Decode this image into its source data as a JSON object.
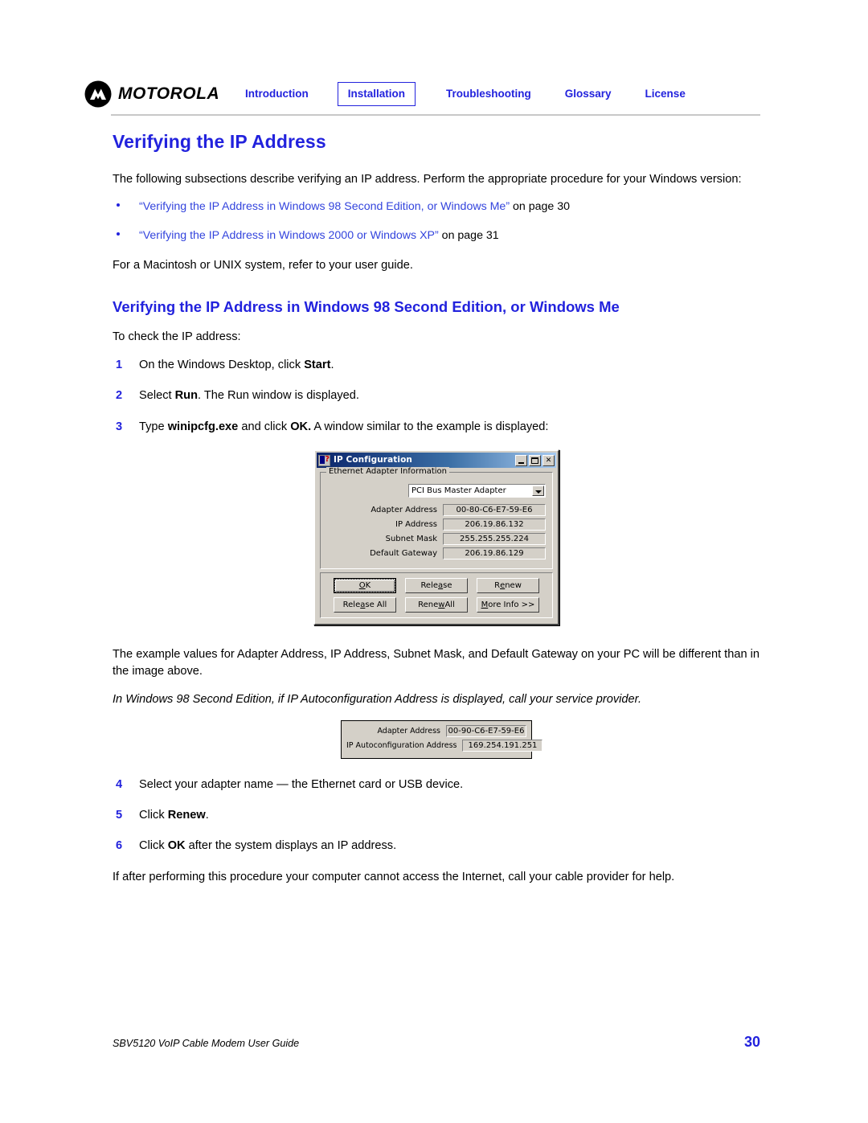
{
  "header": {
    "logo_text": "MOTOROLA",
    "logo_icon": "motorola-batwing-logo",
    "nav": [
      {
        "label": "Introduction",
        "active": false
      },
      {
        "label": "Installation",
        "active": true
      },
      {
        "label": "Troubleshooting",
        "active": false
      },
      {
        "label": "Glossary",
        "active": false
      },
      {
        "label": "License",
        "active": false
      }
    ],
    "accent_color": "#2222dd"
  },
  "main": {
    "title": "Verifying the IP Address",
    "intro": "The following subsections describe verifying an IP address. Perform the appropriate procedure for your Windows version:",
    "bullets": [
      {
        "link": "“Verifying the IP Address in Windows 98 Second Edition, or Windows Me”",
        "suffix": " on page 30"
      },
      {
        "link": "“Verifying the IP Address in Windows 2000 or Windows XP”",
        "suffix": " on page 31"
      }
    ],
    "macintosh_note": "For a Macintosh or UNIX system, refer to your user guide.",
    "subtitle": "Verifying the IP Address in Windows 98 Second Edition, or Windows Me",
    "lead_in": "To check the IP address:",
    "steps_first": [
      {
        "num": "1",
        "pre": "On the Windows Desktop, click ",
        "bold": "Start",
        "post": "."
      },
      {
        "num": "2",
        "pre": "Select ",
        "bold": "Run",
        "post": ". The Run window is displayed."
      },
      {
        "num": "3",
        "pre": "Type ",
        "bold": "winipcfg.exe",
        "mid": " and click ",
        "bold2": "OK.",
        "post": " A window similar to the example is displayed:"
      }
    ],
    "after_dialog": "The example values for Adapter Address, IP Address, Subnet Mask, and Default Gateway on your PC will be different than in the image above.",
    "italic_note": "In Windows 98 Second Edition, if IP Autoconfiguration Address is displayed, call your service provider.",
    "steps_second": [
      {
        "num": "4",
        "pre": "Select your adapter name — the Ethernet card or USB device.",
        "bold": "",
        "post": ""
      },
      {
        "num": "5",
        "pre": "Click ",
        "bold": "Renew",
        "post": "."
      },
      {
        "num": "6",
        "pre": "Click ",
        "bold": "OK",
        "post": " after the system displays an IP address."
      }
    ],
    "closing": "If after performing this procedure your computer cannot access the Internet, call your cable provider for help."
  },
  "dialog": {
    "title": "IP Configuration",
    "title_icon": "ip-config-icon",
    "window_buttons": [
      {
        "name": "minimize",
        "glyph": ""
      },
      {
        "name": "maximize",
        "glyph": ""
      },
      {
        "name": "close",
        "glyph": "✕"
      }
    ],
    "group_label": "Ethernet  Adapter Information",
    "adapter_selected": "PCI Bus Master Adapter",
    "fields": [
      {
        "label": "Adapter Address",
        "value": "00-80-C6-E7-59-E6"
      },
      {
        "label": "IP Address",
        "value": "206.19.86.132"
      },
      {
        "label": "Subnet Mask",
        "value": "255.255.255.224"
      },
      {
        "label": "Default Gateway",
        "value": "206.19.86.129"
      }
    ],
    "buttons_row1": [
      {
        "label": "OK",
        "accel": "O",
        "default": true
      },
      {
        "label": "Release",
        "accel": "a",
        "default": false
      },
      {
        "label": "Renew",
        "accel": "e",
        "default": false
      }
    ],
    "buttons_row2": [
      {
        "label": "Release All",
        "accel": "a",
        "default": false
      },
      {
        "label": "Renew All",
        "accel": "w",
        "default": false
      },
      {
        "label": "More Info >>",
        "accel": "M",
        "default": false
      }
    ]
  },
  "snippet": {
    "fields": [
      {
        "label": "Adapter Address",
        "value": "00-90-C6-E7-59-E6"
      },
      {
        "label": "IP Autoconfiguration Address",
        "value": "169.254.191.251"
      }
    ]
  },
  "footer": {
    "text": "SBV5120 VoIP Cable Modem User Guide",
    "page": "30"
  }
}
